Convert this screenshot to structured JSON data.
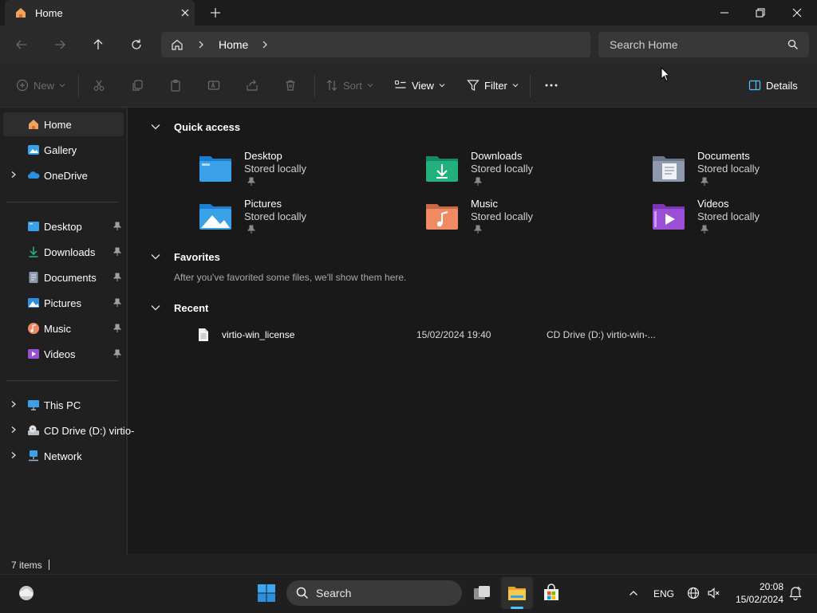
{
  "window": {
    "tab_title": "Home",
    "new_tab_glyph": "+"
  },
  "navigation": {
    "breadcrumb": [
      "Home"
    ],
    "search_placeholder": "Search Home"
  },
  "command_bar": {
    "new_label": "New",
    "sort_label": "Sort",
    "view_label": "View",
    "filter_label": "Filter",
    "details_label": "Details"
  },
  "sidebar": {
    "top_items": [
      {
        "label": "Home",
        "icon": "home-icon",
        "selected": true
      },
      {
        "label": "Gallery",
        "icon": "gallery-icon"
      },
      {
        "label": "OneDrive",
        "icon": "onedrive-icon",
        "expandable": true
      }
    ],
    "pinned_items": [
      {
        "label": "Desktop",
        "icon": "desktop-folder-icon"
      },
      {
        "label": "Downloads",
        "icon": "downloads-icon"
      },
      {
        "label": "Documents",
        "icon": "documents-icon"
      },
      {
        "label": "Pictures",
        "icon": "pictures-icon"
      },
      {
        "label": "Music",
        "icon": "music-icon"
      },
      {
        "label": "Videos",
        "icon": "videos-icon"
      }
    ],
    "drive_items": [
      {
        "label": "This PC",
        "icon": "this-pc-icon"
      },
      {
        "label": "CD Drive (D:) virtio-",
        "icon": "cd-drive-icon"
      },
      {
        "label": "Network",
        "icon": "network-icon"
      }
    ]
  },
  "main": {
    "quick_access": {
      "heading": "Quick access",
      "tiles": [
        {
          "name": "Desktop",
          "sub": "Stored locally",
          "icon": "desktop-folder-icon"
        },
        {
          "name": "Downloads",
          "sub": "Stored locally",
          "icon": "downloads-folder-icon"
        },
        {
          "name": "Documents",
          "sub": "Stored locally",
          "icon": "documents-folder-icon"
        },
        {
          "name": "Pictures",
          "sub": "Stored locally",
          "icon": "pictures-folder-icon"
        },
        {
          "name": "Music",
          "sub": "Stored locally",
          "icon": "music-folder-icon"
        },
        {
          "name": "Videos",
          "sub": "Stored locally",
          "icon": "videos-folder-icon"
        }
      ]
    },
    "favorites": {
      "heading": "Favorites",
      "empty_message": "After you've favorited some files, we'll show them here."
    },
    "recent": {
      "heading": "Recent",
      "rows": [
        {
          "name": "virtio-win_license",
          "date": "15/02/2024 19:40",
          "location": "CD Drive (D:) virtio-win-..."
        }
      ]
    }
  },
  "status": {
    "item_count": "7 items"
  },
  "taskbar": {
    "search_label": "Search",
    "language": "ENG",
    "time": "20:08",
    "date": "15/02/2024"
  },
  "colors": {
    "accent": "#4cc2ff",
    "folder_blue": "#3aa0e8",
    "downloads_green": "#22b07d",
    "documents_gray": "#8e9aab",
    "music_orange": "#f08a63",
    "videos_purple": "#9b4fd6"
  }
}
